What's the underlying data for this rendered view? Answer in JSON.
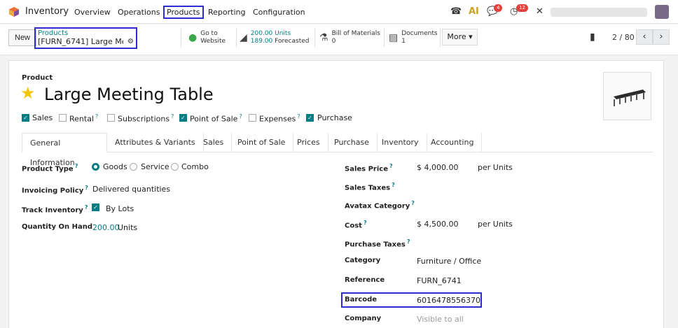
{
  "app": {
    "name": "Inventory"
  },
  "menu": [
    "Overview",
    "Operations",
    "Products",
    "Reporting",
    "Configuration"
  ],
  "systray": {
    "messages_badge": "4",
    "activities_badge": "12"
  },
  "control": {
    "new_label": "New",
    "breadcrumb_parent": "Products",
    "breadcrumb_current": "[FURN_6741] Large Me...",
    "website_line1": "Go to",
    "website_line2": "Website",
    "units_line1": "200.00 Units",
    "units_line2_value": "189.00",
    "units_line2_label": "Forecasted",
    "bom_line1": "Bill of Materials",
    "bom_line2": "0",
    "docs_line1": "Documents",
    "docs_line2": "1",
    "more_label": "More",
    "pager": "2 / 80"
  },
  "product": {
    "label": "Product",
    "name": "Large Meeting Table",
    "options": [
      {
        "label": "Sales",
        "checked": true
      },
      {
        "label": "Rental",
        "checked": false,
        "help": "?"
      },
      {
        "label": "Subscriptions",
        "checked": false,
        "help": "?"
      },
      {
        "label": "Point of Sale",
        "checked": true,
        "help": "?"
      },
      {
        "label": "Expenses",
        "checked": false,
        "help": "?"
      },
      {
        "label": "Purchase",
        "checked": true
      }
    ]
  },
  "tabs": [
    "General Information",
    "Attributes & Variants",
    "Sales",
    "Point of Sale",
    "Prices",
    "Purchase",
    "Inventory",
    "Accounting"
  ],
  "left_fields": {
    "product_type_label": "Product Type",
    "product_type_options": [
      "Goods",
      "Service",
      "Combo"
    ],
    "invoicing_policy_label": "Invoicing Policy",
    "invoicing_policy_value": "Delivered quantities",
    "track_inventory_label": "Track Inventory",
    "track_inventory_value": "By Lots",
    "qty_on_hand_label": "Quantity On Hand",
    "qty_on_hand_value": "200.00",
    "qty_on_hand_unit": "Units"
  },
  "right_fields": {
    "sales_price_label": "Sales Price",
    "sales_price_value": "$ 4,000.00",
    "sales_price_unit": "per Units",
    "sales_taxes_label": "Sales Taxes",
    "avatax_label": "Avatax Category",
    "cost_label": "Cost",
    "cost_value": "$ 4,500.00",
    "cost_unit": "per Units",
    "purchase_taxes_label": "Purchase Taxes",
    "category_label": "Category",
    "category_value": "Furniture / Office",
    "reference_label": "Reference",
    "reference_value": "FURN_6741",
    "barcode_label": "Barcode",
    "barcode_value": "6016478556370",
    "company_label": "Company",
    "company_placeholder": "Visible to all"
  },
  "help_mark": "?"
}
